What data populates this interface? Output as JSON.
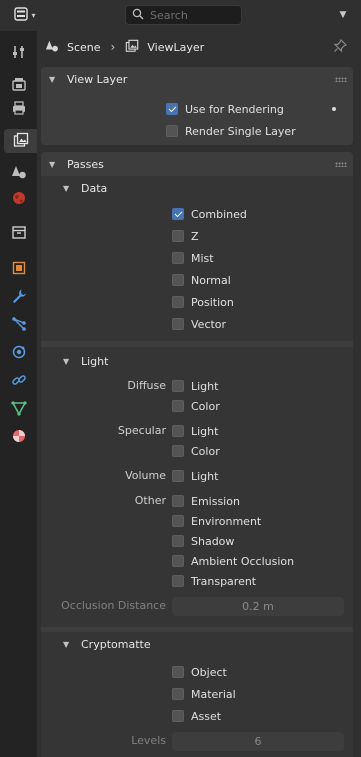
{
  "header": {
    "search_placeholder": "Search"
  },
  "breadcrumb": {
    "scene": "Scene",
    "view_layer": "ViewLayer"
  },
  "tabs": [
    {
      "name": "tool-tab",
      "icon": "wrench-screwdriver-icon"
    },
    {
      "name": "render-tab",
      "icon": "camera-back-icon"
    },
    {
      "name": "output-tab",
      "icon": "printer-icon"
    },
    {
      "name": "view-layer-tab",
      "icon": "images-icon",
      "active": true
    },
    {
      "name": "scene-tab",
      "icon": "cone-sphere-icon"
    },
    {
      "name": "world-tab",
      "icon": "globe-icon"
    },
    {
      "name": "collection-tab",
      "icon": "box-icon"
    },
    {
      "name": "object-tab",
      "icon": "square-orange-icon"
    },
    {
      "name": "modifiers-tab",
      "icon": "wrench-icon"
    },
    {
      "name": "particles-tab",
      "icon": "particles-icon"
    },
    {
      "name": "physics-tab",
      "icon": "orbit-icon"
    },
    {
      "name": "constraints-tab",
      "icon": "link-icon"
    },
    {
      "name": "data-tab",
      "icon": "triangle-vertex-icon"
    },
    {
      "name": "material-tab",
      "icon": "checker-sphere-icon"
    }
  ],
  "view_layer_panel": {
    "title": "View Layer",
    "use_for_rendering": {
      "label": "Use for Rendering",
      "checked": true
    },
    "render_single_layer": {
      "label": "Render Single Layer",
      "checked": false
    }
  },
  "passes": {
    "title": "Passes",
    "data": {
      "title": "Data",
      "items": [
        {
          "label": "Combined",
          "checked": true
        },
        {
          "label": "Z",
          "checked": false
        },
        {
          "label": "Mist",
          "checked": false
        },
        {
          "label": "Normal",
          "checked": false
        },
        {
          "label": "Position",
          "checked": false
        },
        {
          "label": "Vector",
          "checked": false
        }
      ]
    },
    "light": {
      "title": "Light",
      "diffuse_label": "Diffuse",
      "diffuse_light": "Light",
      "diffuse_color": "Color",
      "specular_label": "Specular",
      "specular_light": "Light",
      "specular_color": "Color",
      "volume_label": "Volume",
      "volume_light": "Light",
      "other_label": "Other",
      "emission": "Emission",
      "environment": "Environment",
      "shadow": "Shadow",
      "ambient_occlusion": "Ambient Occlusion",
      "transparent": "Transparent",
      "occlusion_distance_label": "Occlusion Distance",
      "occlusion_distance_value": "0.2 m"
    },
    "cryptomatte": {
      "title": "Cryptomatte",
      "object": "Object",
      "material": "Material",
      "asset": "Asset",
      "levels_label": "Levels",
      "levels_value": "6"
    }
  },
  "colors": {
    "accent": "#4772b3",
    "panel": "#3d3d3d",
    "background": "#303030"
  }
}
